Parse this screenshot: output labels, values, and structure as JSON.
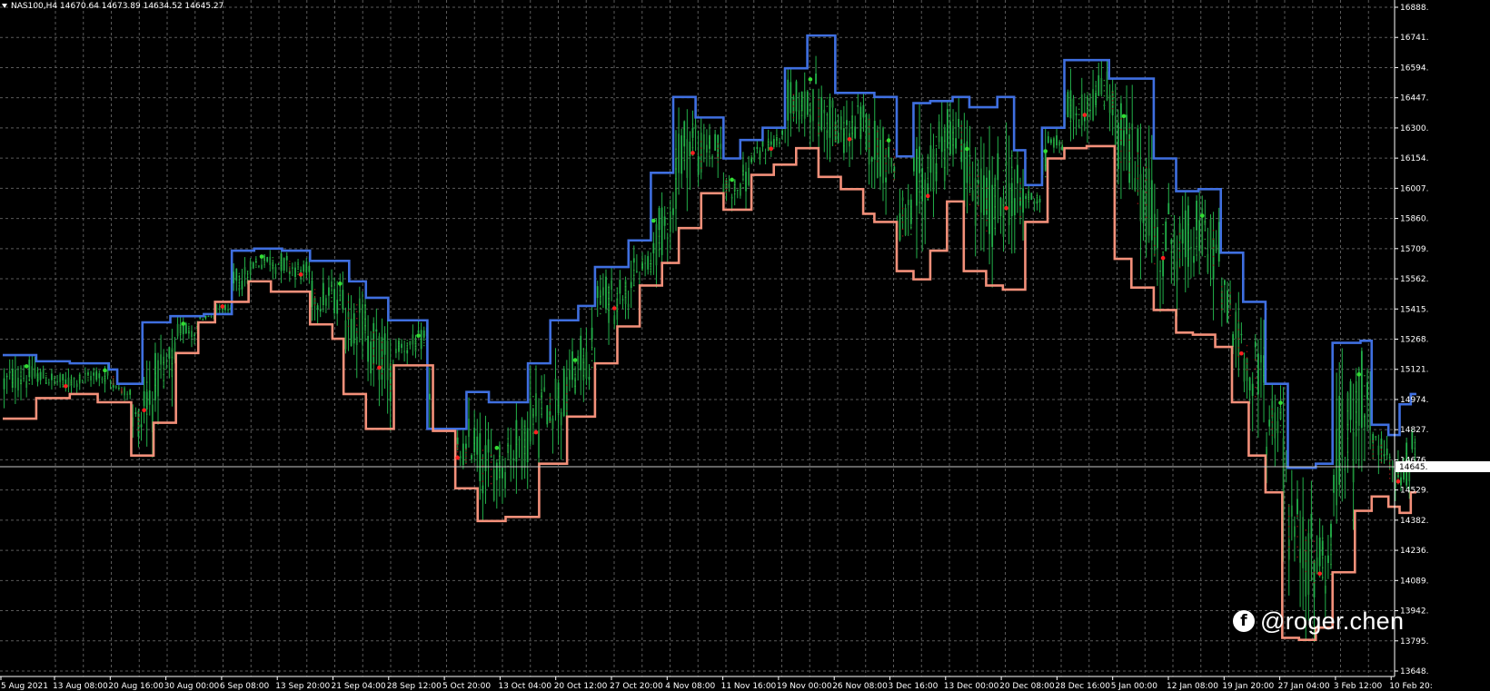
{
  "window": {
    "symbol_info": "NAS100,H4  14670.64 14673.89 14634.52 14645.27"
  },
  "watermark": {
    "icon": "facebook-icon",
    "handle": "@roger.chen"
  },
  "colors": {
    "background": "#000000",
    "grid": "#5a5a5a",
    "upper_band": "#3f6fe0",
    "lower_band": "#f3907a",
    "candle_bull": "#22b04a",
    "candle_bear": "#1f8f3a",
    "ribbon_up": "#33c040",
    "ribbon_down": "#b01818",
    "signal_up": "#33dd33",
    "signal_down": "#ff2020"
  },
  "chart_data": {
    "type": "line",
    "symbol": "NAS100",
    "timeframe": "H4",
    "current_price": 14645.27,
    "ylim": [
      13648,
      16888
    ],
    "y_ticks": [
      "16888.",
      "16741.",
      "16594.",
      "16447.",
      "16300.",
      "16154.",
      "16007.",
      "15860.",
      "15709.",
      "15562.",
      "15415.",
      "15268.",
      "15121.",
      "14974.",
      "14827.",
      "14676.",
      "14529.",
      "14382.",
      "14236.",
      "14089.",
      "13942.",
      "13795.",
      "13648."
    ],
    "price_label": "14645.",
    "x_ticks": [
      "5 Aug 2021",
      "13 Aug 08:00",
      "20 Aug 16:00",
      "30 Aug 00:00",
      "6 Sep 08:00",
      "13 Sep 20:00",
      "21 Sep 04:00",
      "28 Sep 12:00",
      "5 Oct 20:00",
      "13 Oct 04:00",
      "20 Oct 12:00",
      "27 Oct 20:00",
      "4 Nov 08:00",
      "11 Nov 16:00",
      "19 Nov 00:00",
      "26 Nov 08:00",
      "3 Dec 16:00",
      "13 Dec 00:00",
      "20 Dec 08:00",
      "28 Dec 16:00",
      "5 Jan 00:00",
      "12 Jan 08:00",
      "19 Jan 20:00",
      "27 Jan 04:00",
      "3 Feb 12:00",
      "10 Feb 20:"
    ],
    "x_range": [
      0,
      25.3
    ],
    "grid": true,
    "series": [
      {
        "style": "step",
        "x": [
          0,
          0.6,
          1.2,
          1.9,
          2.05,
          2.5,
          3.0,
          3.6,
          4.1,
          4.5,
          5.0,
          5.5,
          6.2,
          6.5,
          6.9,
          7.6,
          7.9,
          8.3,
          8.7,
          9.4,
          9.8,
          10.3,
          10.6,
          11.2,
          11.6,
          12.0,
          12.4,
          12.9,
          13.2,
          13.6,
          14.0,
          14.4,
          14.9,
          15.2,
          15.6,
          16.0,
          16.3,
          16.6,
          17.0,
          17.3,
          17.8,
          18.1,
          18.3,
          18.6,
          19.0,
          19.3,
          19.8,
          20.3,
          20.6,
          21.0,
          21.4,
          21.8,
          22.2,
          22.6,
          23.0,
          23.3,
          23.5,
          23.8,
          24.3,
          24.5,
          24.8,
          25.0,
          25.2
        ],
        "values": [
          15190,
          15160,
          15150,
          15120,
          15050,
          15350,
          15380,
          15390,
          15700,
          15710,
          15700,
          15650,
          15550,
          15470,
          15360,
          14830,
          14830,
          15010,
          14960,
          15150,
          15360,
          15430,
          15620,
          15750,
          16080,
          16450,
          16350,
          16150,
          16240,
          16300,
          16590,
          16750,
          16470,
          16470,
          16450,
          16160,
          16420,
          16430,
          16450,
          16400,
          16450,
          16190,
          16020,
          16300,
          16630,
          16630,
          16540,
          16540,
          16150,
          15990,
          16000,
          15690,
          15450,
          15050,
          14640,
          14640,
          14660,
          15250,
          15260,
          14850,
          14800,
          14950,
          15000
        ]
      },
      {
        "style": "step",
        "x": [
          0,
          0.6,
          1.2,
          1.7,
          2.3,
          2.7,
          3.1,
          3.5,
          3.8,
          4.4,
          4.8,
          5.5,
          5.9,
          6.1,
          6.5,
          7.0,
          7.7,
          8.1,
          8.5,
          9.0,
          9.6,
          10.1,
          10.6,
          11.0,
          11.4,
          11.8,
          12.1,
          12.5,
          12.9,
          13.4,
          13.8,
          14.2,
          14.6,
          15.0,
          15.4,
          15.6,
          16.0,
          16.3,
          16.6,
          16.9,
          17.2,
          17.6,
          17.9,
          18.3,
          18.7,
          19.0,
          19.4,
          19.9,
          20.2,
          20.6,
          21.0,
          21.3,
          21.7,
          22.0,
          22.3,
          22.6,
          22.9,
          23.2,
          23.5,
          23.8,
          24.2,
          24.5,
          24.8,
          25.0,
          25.2
        ],
        "values": [
          14880,
          14980,
          15000,
          14960,
          14700,
          14860,
          15200,
          15350,
          15450,
          15550,
          15500,
          15340,
          15270,
          15000,
          14830,
          15140,
          14820,
          14540,
          14380,
          14400,
          14660,
          14890,
          15150,
          15330,
          15530,
          15640,
          15810,
          15980,
          15900,
          16070,
          16120,
          16200,
          16060,
          16000,
          15880,
          15840,
          15600,
          15560,
          15700,
          15940,
          15600,
          15530,
          15510,
          15840,
          16150,
          16200,
          16210,
          15660,
          15520,
          15410,
          15300,
          15290,
          15230,
          14960,
          14700,
          14520,
          13810,
          13800,
          13860,
          14130,
          14430,
          14500,
          14450,
          14420,
          14520
        ]
      }
    ]
  }
}
